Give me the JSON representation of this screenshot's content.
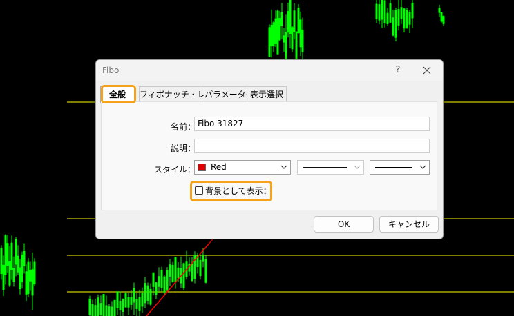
{
  "dialog": {
    "title": "Fibo",
    "help_symbol": "?",
    "tabs": [
      {
        "label": "全般",
        "active": true
      },
      {
        "label": "フィボナッチ・レベル",
        "active": false
      },
      {
        "label": "パラメーター",
        "active": false
      },
      {
        "label": "表示選択",
        "active": false
      }
    ],
    "form": {
      "name_label": "名前：",
      "name_value": "Fibo 31827",
      "description_label": "説明：",
      "description_value": "",
      "style_label": "スタイル：",
      "color_value": "Red",
      "color_hex": "#e00000",
      "background_checkbox_label": "背景として表示：",
      "background_checked": false
    },
    "buttons": {
      "ok": "OK",
      "cancel": "キャンセル"
    }
  },
  "colors": {
    "highlight": "#f5a31a",
    "chart_background": "#000000",
    "candles": "#00ff00",
    "fibo_levels": "#ffff00",
    "trend_line": "#ff0000"
  },
  "icons": [
    "help-icon",
    "close-icon",
    "chevron-down-icon"
  ]
}
